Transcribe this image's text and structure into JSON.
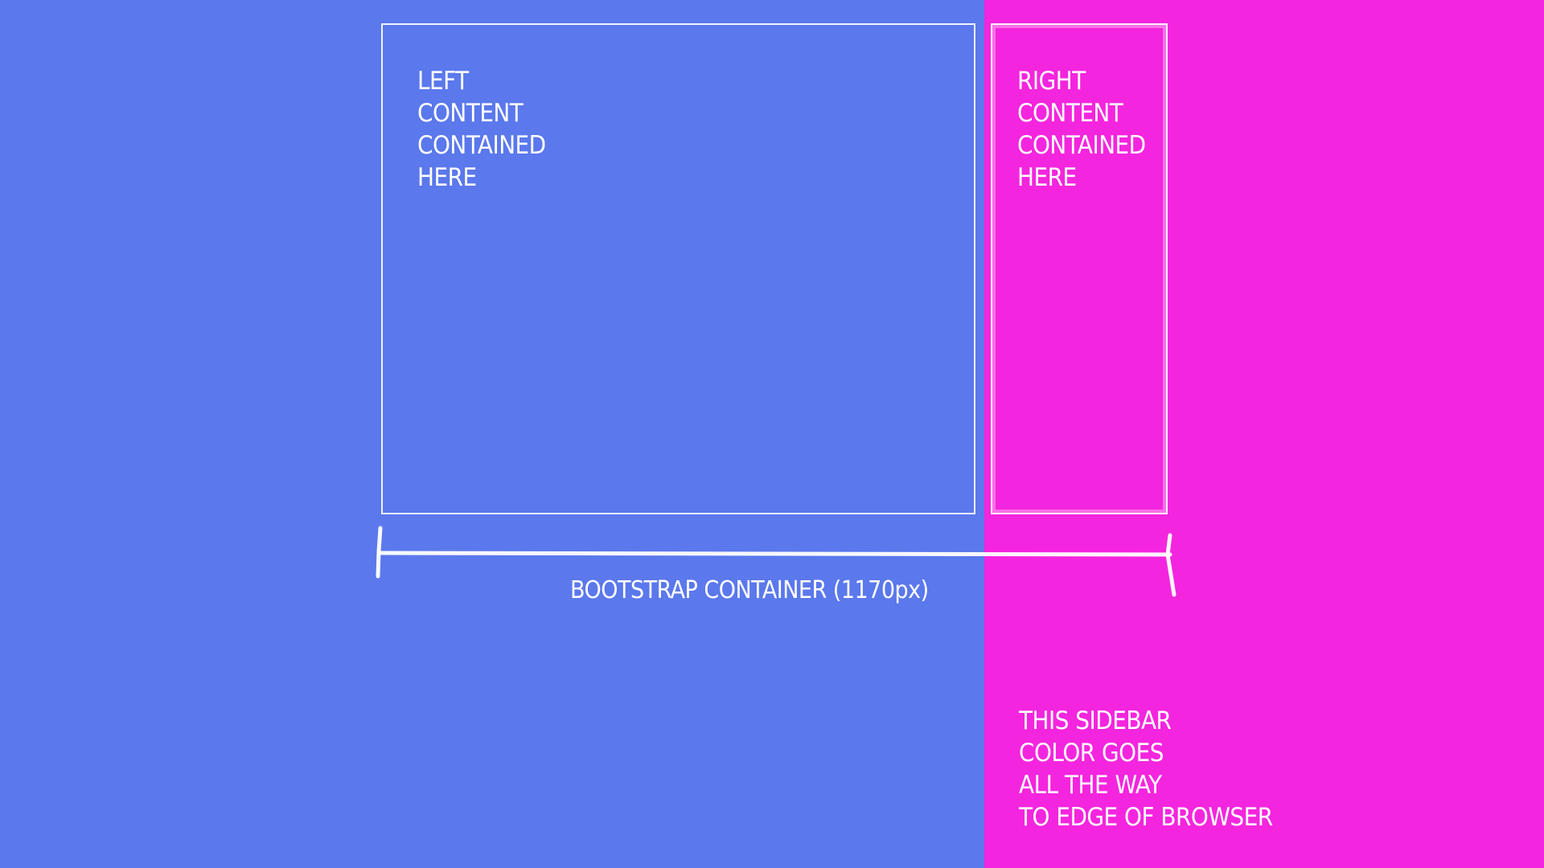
{
  "left_box": {
    "lines": [
      "LEFT",
      "CONTENT",
      "CONTAINED",
      "HERE"
    ]
  },
  "right_box": {
    "lines": [
      "RIGHT",
      "CONTENT",
      "CONTAINED",
      "HERE"
    ]
  },
  "container_caption": "BOOTSTRAP CONTAINER (1170px)",
  "sidebar_note": {
    "lines": [
      "THIS SIDEBAR",
      "COLOR GOES",
      "ALL THE WAY",
      "TO EDGE OF BROWSER"
    ]
  },
  "colors": {
    "main_background": "#5b78ec",
    "sidebar_background": "#f425de",
    "outline": "#ffffff"
  }
}
